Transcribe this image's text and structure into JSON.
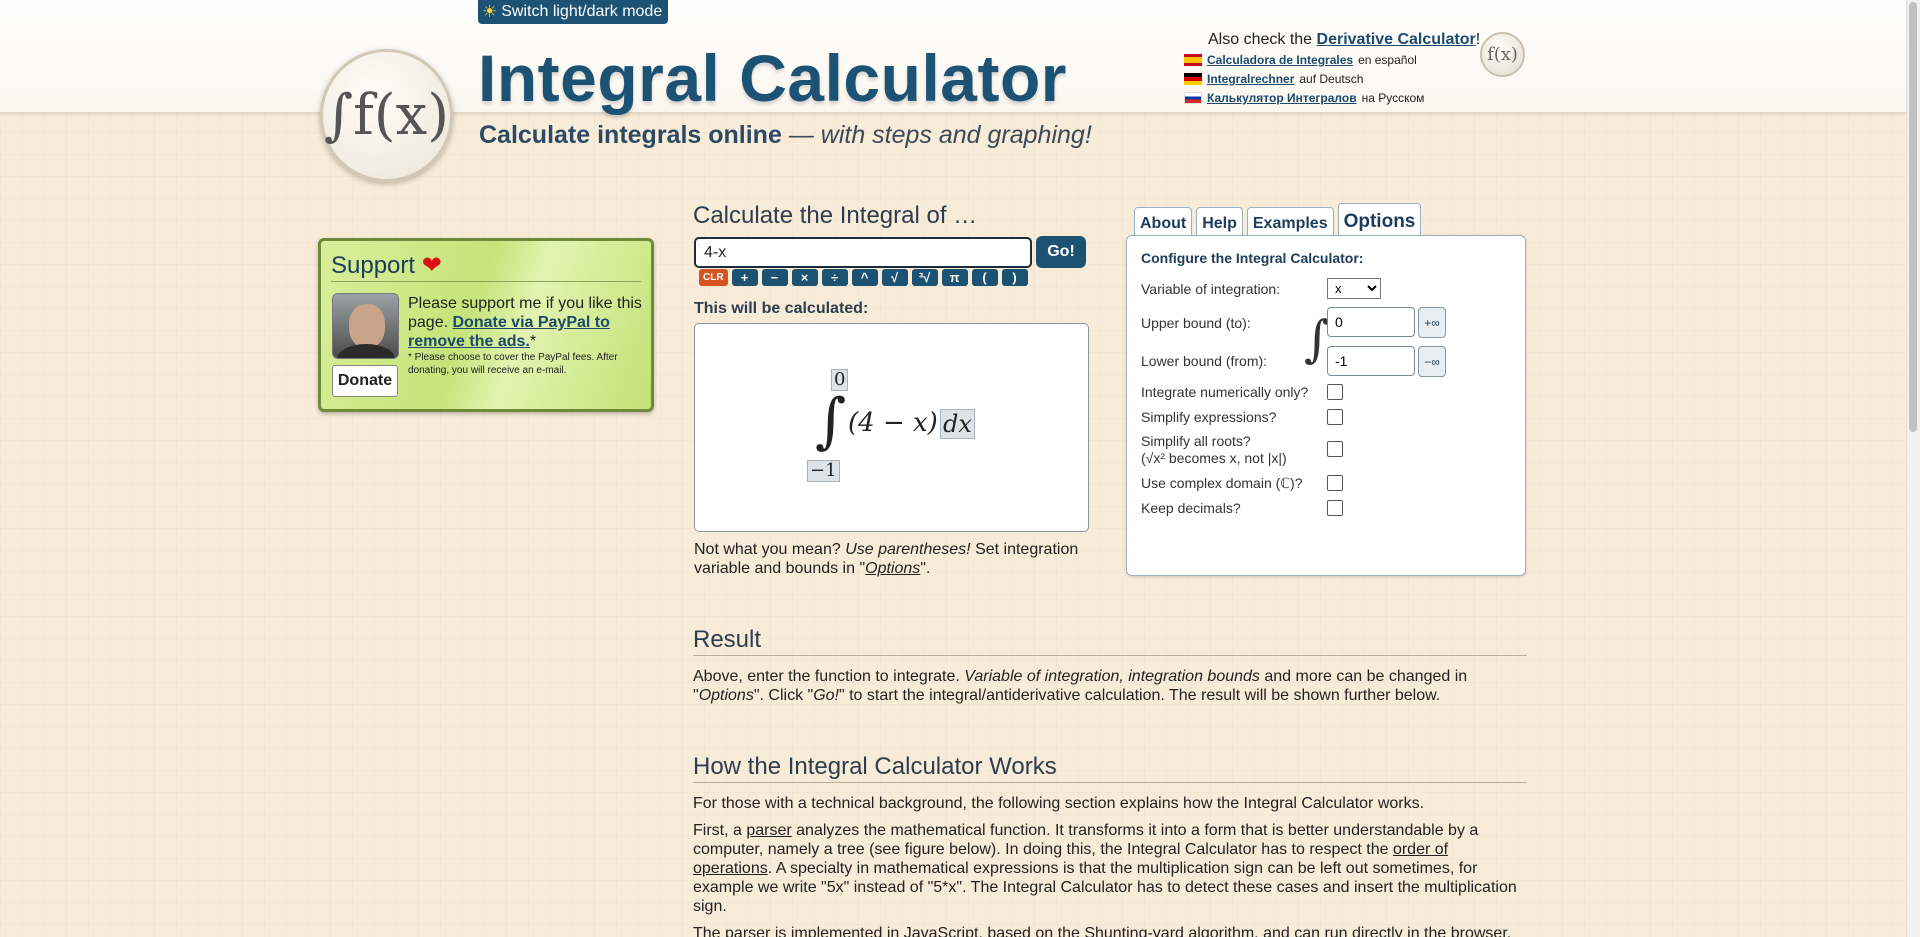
{
  "header": {
    "switch_mode": "Switch light/dark mode",
    "title": "Integral Calculator",
    "subtitle_bold": "Calculate integrals online",
    "subtitle_rest": "— with steps and graphing!",
    "also_prefix": "Also check the",
    "also_link": "Derivative Calculator",
    "also_suffix": "!",
    "languages": [
      {
        "link": "Calculadora de Integrales",
        "suffix": "en español",
        "flag": "es"
      },
      {
        "link": "Integralrechner",
        "suffix": "auf Deutsch",
        "flag": "de"
      },
      {
        "link": "Калькулятор Интегралов",
        "suffix": "на Русском",
        "flag": "ru"
      }
    ],
    "logo_text": "∫f(x)",
    "deriv_logo_text": "f(x)"
  },
  "support": {
    "title": "Support",
    "message_plain": "Please support me if you like this page.",
    "message_link": "Donate via PayPal to remove the ads.",
    "asterisk": "*",
    "note": "* Please choose to cover the PayPal fees. After donating, you will receive an e-mail.",
    "donate": "Donate"
  },
  "calculator": {
    "heading": "Calculate the Integral of …",
    "input_value": "4-x",
    "go": "Go!",
    "keys": [
      "CLR",
      "+",
      "−",
      "×",
      "÷",
      "^",
      "√",
      "³√",
      "π",
      "(",
      ")"
    ],
    "will_calc": "This will be calculated:",
    "preview": {
      "upper": "0",
      "lower": "−1",
      "integrand": "(4 − x)",
      "differential": "dx"
    },
    "not_mean_1": "Not what you mean?",
    "not_mean_2": "Use parentheses!",
    "not_mean_3": "Set integration variable and bounds in \"",
    "not_mean_link": "Options",
    "not_mean_4": "\"."
  },
  "tabs": [
    {
      "label": "About",
      "active": false
    },
    {
      "label": "Help",
      "active": false
    },
    {
      "label": "Examples",
      "active": false
    },
    {
      "label": "Options",
      "active": true
    }
  ],
  "options": {
    "title": "Configure the Integral Calculator:",
    "variable_label": "Variable of integration:",
    "variable_value": "x",
    "upper_label": "Upper bound (to):",
    "upper_value": "0",
    "upper_btn": "+∞",
    "lower_label": "Lower bound (from):",
    "lower_value": "-1",
    "lower_btn": "−∞",
    "checks": [
      {
        "label": "Integrate numerically only?",
        "checked": false
      },
      {
        "label": "Simplify expressions?",
        "checked": false
      },
      {
        "label": "Simplify all roots?",
        "label2": "(√x² becomes x, not |x|)",
        "checked": false
      },
      {
        "label": "Use complex domain (ℂ)?",
        "checked": false
      },
      {
        "label": "Keep decimals?",
        "checked": false
      }
    ]
  },
  "result": {
    "heading": "Result",
    "text_1": "Above, enter the function to integrate.",
    "text_2": "Variable of integration, integration bounds",
    "text_3": "and more can be changed in \"",
    "text_4": "Options",
    "text_5": "\". Click \"",
    "text_6": "Go!",
    "text_7": "\" to start the integral/antiderivative calculation. The result will be shown further below."
  },
  "how": {
    "heading": "How the Integral Calculator Works",
    "p1": "For those with a technical background, the following section explains how the Integral Calculator works.",
    "p2_a": "First, a",
    "p2_link1": "parser",
    "p2_b": "analyzes the mathematical function. It transforms it into a form that is better understandable by a computer, namely a tree (see figure below). In doing this, the Integral Calculator has to respect the",
    "p2_link2": "order of operations",
    "p2_c": ". A specialty in mathematical expressions is that the multiplication sign can be left out sometimes, for example we write \"5x\" instead of \"5*x\". The Integral Calculator has to detect these cases and insert the multiplication sign.",
    "p3": "The parser is implemented in JavaScript, based on the Shunting-yard algorithm, and can run directly in the browser."
  }
}
